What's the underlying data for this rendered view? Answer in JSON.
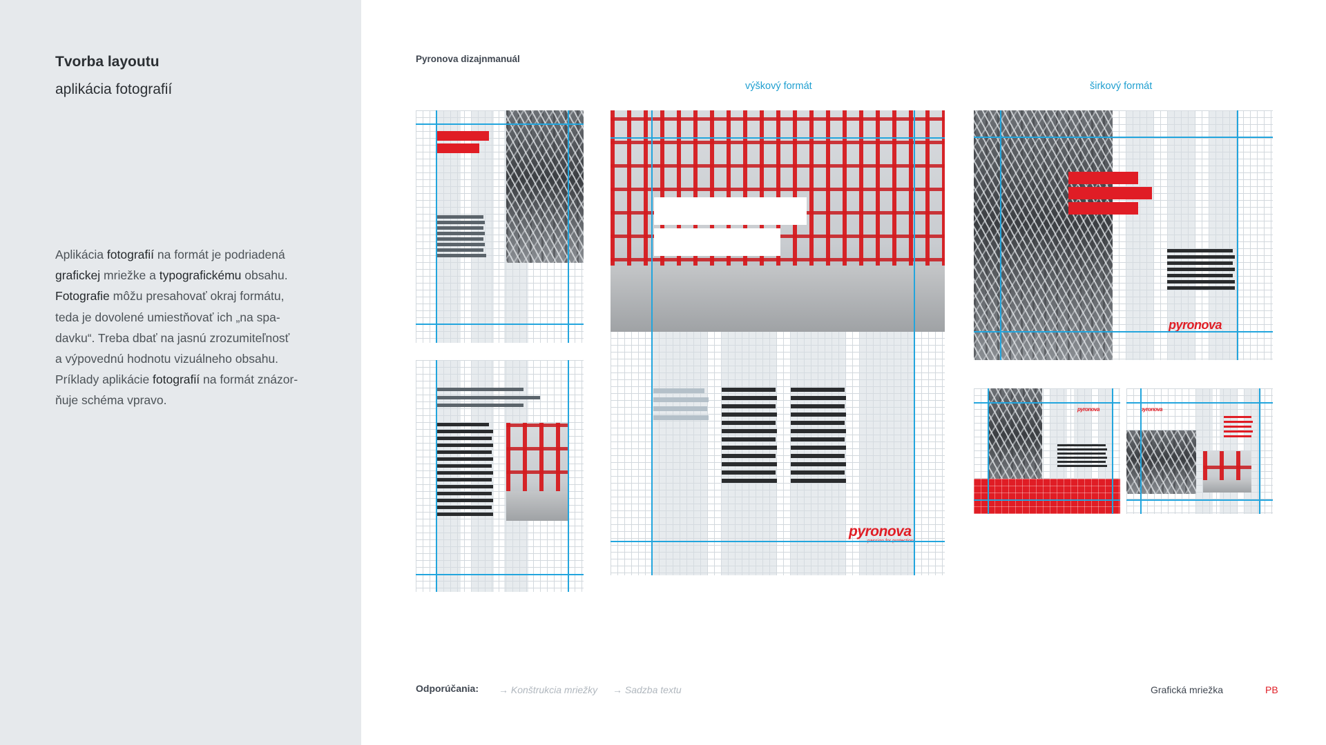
{
  "sidebar": {
    "title": "Tvorba layoutu",
    "subtitle": "aplikácia fotografií",
    "paragraph": [
      [
        {
          "t": "Aplikácia "
        },
        {
          "t": "fotografií",
          "b": 1
        },
        {
          "t": " na formát je podriadená"
        }
      ],
      [
        {
          "t": "grafickej",
          "b": 1
        },
        {
          "t": " mriežke a "
        },
        {
          "t": "typografickému",
          "b": 1
        },
        {
          "t": " obsahu."
        }
      ],
      [
        {
          "t": "Fotografie",
          "b": 1
        },
        {
          "t": " môžu presahovať okraj formátu,"
        }
      ],
      [
        {
          "t": "teda je dovolené umiestňovať ich „na spa-"
        }
      ],
      [
        {
          "t": "davku“. Treba dbať na jasnú zrozumiteľnosť"
        }
      ],
      [
        {
          "t": "a výpovednú hodnotu vizuálneho obsahu."
        }
      ],
      [
        {
          "t": "Príklady aplikácie "
        },
        {
          "t": "fotografií",
          "b": 1
        },
        {
          "t": " na formát znázor-"
        }
      ],
      [
        {
          "t": "ňuje schéma vpravo."
        }
      ]
    ]
  },
  "main": {
    "manual_title": "Pyronova dizajnmanuál",
    "portrait_label": "výškový formát",
    "landscape_label": "širkový formát",
    "logo_text": "pyronova",
    "logo_tagline": "passion for protection"
  },
  "footer": {
    "recommendations_label": "Odporúčania:",
    "links": [
      "→ Konštrukcia mriežky",
      "→ Sadzba textu"
    ],
    "section": "Grafická mriežka",
    "code": "PB"
  },
  "colors": {
    "accent_red": "#e01d25",
    "grid_blue": "#22a5dd",
    "sidebar_bg": "#e6e9ec",
    "label_blue": "#1f9fd0"
  }
}
